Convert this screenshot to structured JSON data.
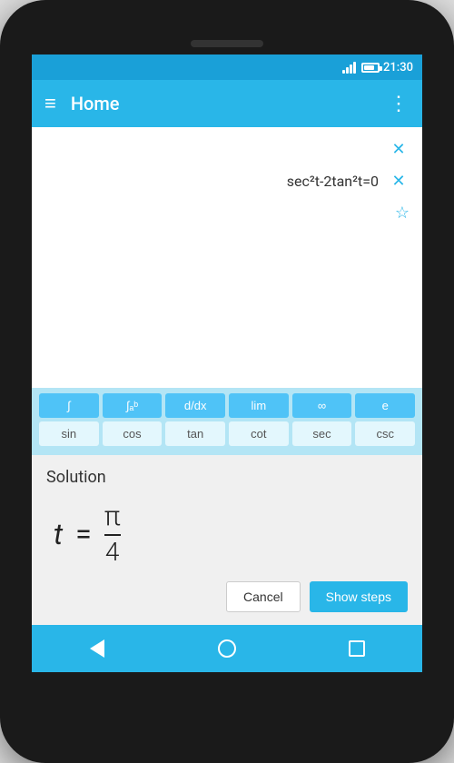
{
  "status_bar": {
    "time": "21:30"
  },
  "app_bar": {
    "title": "Home",
    "menu_icon": "≡",
    "more_icon": "⋮"
  },
  "expressions": [
    {
      "id": "expr-1",
      "text": "",
      "has_close": true,
      "has_close_only": true
    },
    {
      "id": "expr-2",
      "text": "sec²t-2tan²t=0",
      "has_close": true
    },
    {
      "id": "expr-3",
      "text": "",
      "has_star": true
    }
  ],
  "keyboard": {
    "row1": [
      "∫",
      "∫ₐᵇ",
      "d/dx",
      "lim",
      "∞",
      "e"
    ],
    "row2": [
      "sin",
      "cos",
      "tan",
      "cot",
      "sec",
      "csc"
    ]
  },
  "solution": {
    "title": "Solution",
    "variable": "t",
    "equals": "=",
    "numerator": "π",
    "denominator": "4"
  },
  "buttons": {
    "cancel": "Cancel",
    "show_steps": "Show steps"
  },
  "bottom_nav": {
    "back": "◁",
    "home": "○",
    "recents": "□"
  },
  "colors": {
    "primary": "#29b6e8",
    "dark_primary": "#1aa0d8",
    "background": "#f5f5f5",
    "solution_bg": "#f0f0f0"
  }
}
